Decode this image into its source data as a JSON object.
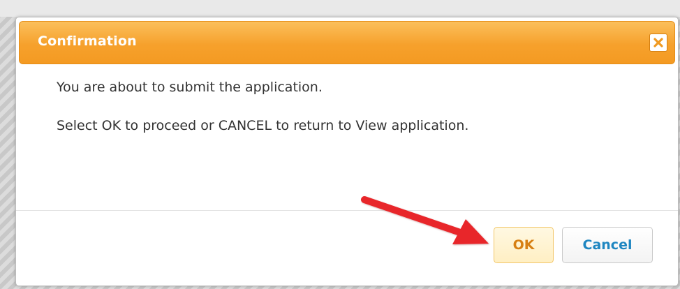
{
  "dialog": {
    "title": "Confirmation",
    "message_line_1": "You are about to submit the application.",
    "message_line_2": "Select OK to proceed or CANCEL to return to View application.",
    "ok_label": "OK",
    "cancel_label": "Cancel",
    "close_icon": "close-icon"
  },
  "colors": {
    "header_orange": "#f6a12c",
    "ok_text": "#d77f12",
    "cancel_text": "#1e86c1",
    "annotation_arrow": "#e8262a"
  }
}
